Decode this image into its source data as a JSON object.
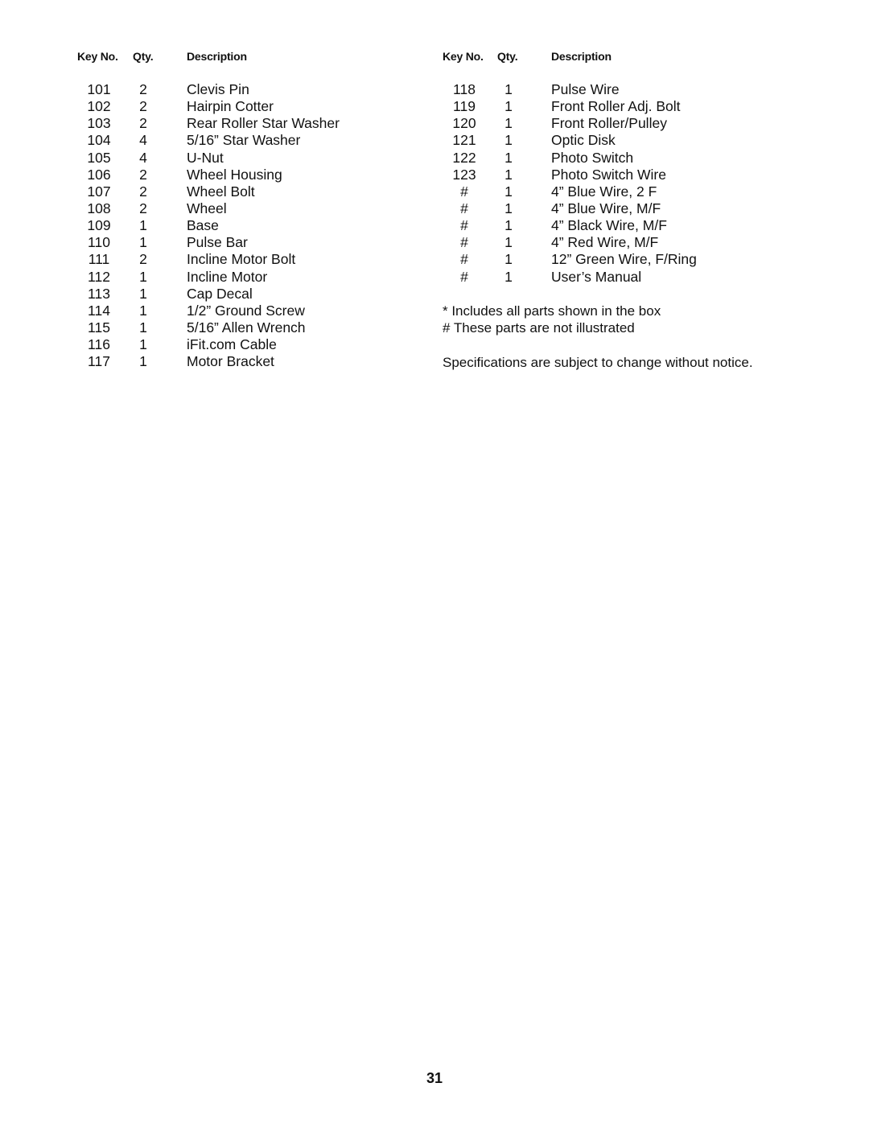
{
  "headers": {
    "key_no": "Key No.",
    "qty": "Qty.",
    "description": "Description"
  },
  "left_parts": [
    {
      "key": "101",
      "qty": "2",
      "description": "Clevis Pin"
    },
    {
      "key": "102",
      "qty": "2",
      "description": "Hairpin Cotter"
    },
    {
      "key": "103",
      "qty": "2",
      "description": "Rear Roller Star Washer"
    },
    {
      "key": "104",
      "qty": "4",
      "description": "5/16” Star Washer"
    },
    {
      "key": "105",
      "qty": "4",
      "description": "U-Nut"
    },
    {
      "key": "106",
      "qty": "2",
      "description": "Wheel Housing"
    },
    {
      "key": "107",
      "qty": "2",
      "description": "Wheel Bolt"
    },
    {
      "key": "108",
      "qty": "2",
      "description": "Wheel"
    },
    {
      "key": "109",
      "qty": "1",
      "description": "Base"
    },
    {
      "key": "110",
      "qty": "1",
      "description": "Pulse Bar"
    },
    {
      "key": "111",
      "qty": "2",
      "description": "Incline Motor Bolt"
    },
    {
      "key": "112",
      "qty": "1",
      "description": "Incline Motor"
    },
    {
      "key": "113",
      "qty": "1",
      "description": "Cap Decal"
    },
    {
      "key": "114",
      "qty": "1",
      "description": "1/2” Ground Screw"
    },
    {
      "key": "115",
      "qty": "1",
      "description": "5/16” Allen Wrench"
    },
    {
      "key": "116",
      "qty": "1",
      "description": "iFit.com Cable"
    },
    {
      "key": "117",
      "qty": "1",
      "description": "Motor Bracket"
    }
  ],
  "right_parts": [
    {
      "key": "118",
      "qty": "1",
      "description": "Pulse Wire"
    },
    {
      "key": "119",
      "qty": "1",
      "description": "Front Roller Adj. Bolt"
    },
    {
      "key": "120",
      "qty": "1",
      "description": "Front Roller/Pulley"
    },
    {
      "key": "121",
      "qty": "1",
      "description": "Optic Disk"
    },
    {
      "key": "122",
      "qty": "1",
      "description": "Photo Switch"
    },
    {
      "key": "123",
      "qty": "1",
      "description": "Photo Switch Wire"
    },
    {
      "key": "#",
      "qty": "1",
      "description": "4” Blue Wire, 2 F"
    },
    {
      "key": "#",
      "qty": "1",
      "description": "4” Blue Wire, M/F"
    },
    {
      "key": "#",
      "qty": "1",
      "description": "4” Black Wire, M/F"
    },
    {
      "key": "#",
      "qty": "1",
      "description": "4” Red Wire, M/F"
    },
    {
      "key": "#",
      "qty": "1",
      "description": "12” Green Wire, F/Ring"
    },
    {
      "key": "#",
      "qty": "1",
      "description": "User’s Manual"
    }
  ],
  "notes": {
    "asterisk": "* Includes all parts shown in the box",
    "hash": "# These parts are not illustrated",
    "specs": "Specifications are subject to change without notice."
  },
  "page_number": "31"
}
